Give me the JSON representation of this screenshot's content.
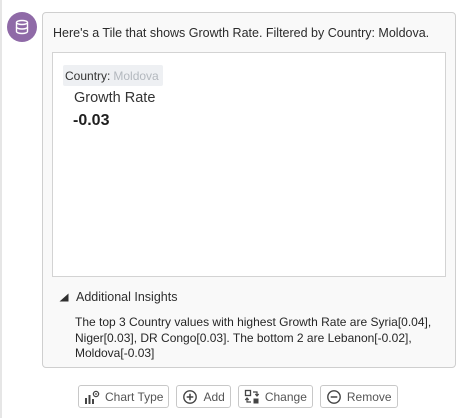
{
  "message": {
    "text": "Here's a Tile that shows Growth Rate. Filtered by Country: Moldova."
  },
  "tile": {
    "filter_label": "Country:",
    "filter_value": "Moldova",
    "metric_name": "Growth Rate",
    "metric_value": "-0.03"
  },
  "insights": {
    "header": "Additional Insights",
    "text": "The top 3 Country values with highest Growth Rate are Syria[0.04], Niger[0.03], DR Congo[0.03]. The bottom 2 are Lebanon[-0.02], Moldova[-0.03]"
  },
  "actions": {
    "chart_type": "Chart Type",
    "add": "Add",
    "change": "Change",
    "remove": "Remove"
  },
  "colors": {
    "avatar": "#8f6aa7",
    "bubble_bg": "#f9f9f9",
    "filter_pill_bg": "#eef0f3"
  },
  "icons": {
    "avatar": "database-icon",
    "insights_toggle": "triangle-icon",
    "chart_type": "chart-type-icon",
    "add": "plus-circle-icon",
    "change": "change-icon",
    "remove": "minus-circle-icon"
  }
}
